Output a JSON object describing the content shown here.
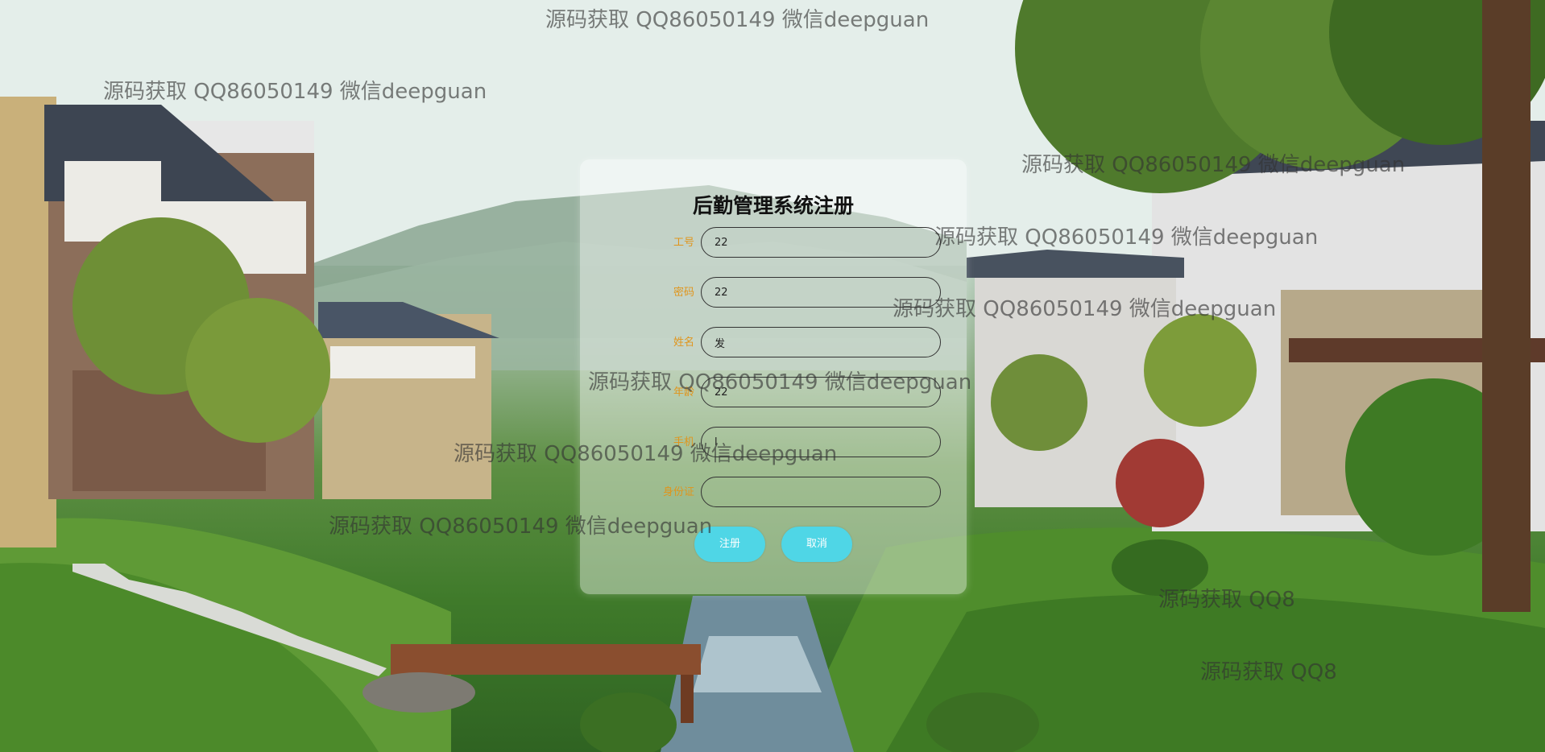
{
  "form": {
    "title": "后勤管理系统注册",
    "fields": [
      {
        "label": "工号",
        "value": "22"
      },
      {
        "label": "密码",
        "value": "22"
      },
      {
        "label": "姓名",
        "value": "发"
      },
      {
        "label": "年龄",
        "value": "22"
      },
      {
        "label": "手机",
        "value": "l"
      },
      {
        "label": "身份证",
        "value": ""
      }
    ],
    "register_label": "注册",
    "cancel_label": "取消"
  },
  "watermark": {
    "text": "源码获取 QQ86050149 微信deepguan",
    "partial_text": "源码获取 QQ8"
  },
  "colors": {
    "label": "#e0951c",
    "button": "#4fd6e6",
    "panel": "rgba(255,255,255,0.42)"
  }
}
